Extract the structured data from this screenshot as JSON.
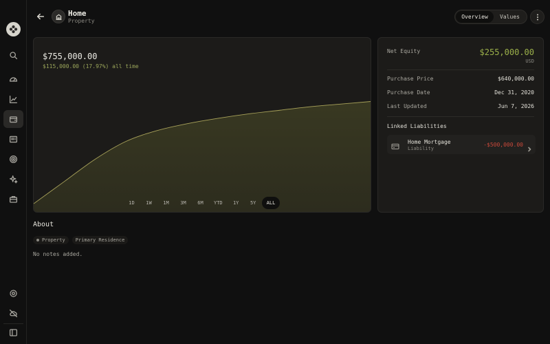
{
  "header": {
    "back_icon": "arrow-left-icon",
    "asset_icon": "building-icon",
    "title": "Home",
    "subtitle": "Property",
    "tabs": [
      {
        "label": "Overview",
        "active": true
      },
      {
        "label": "Values",
        "active": false
      }
    ],
    "more_icon": "more-vertical-icon"
  },
  "sidebar": {
    "logo_icon": "app-logo-icon",
    "items": [
      {
        "icon": "search-icon",
        "active": false
      },
      {
        "icon": "dashboard-gauge-icon",
        "active": false
      },
      {
        "icon": "chart-icon",
        "active": false
      },
      {
        "icon": "wallet-icon",
        "active": true
      },
      {
        "icon": "receipt-icon",
        "active": false
      },
      {
        "icon": "target-icon",
        "active": false
      },
      {
        "icon": "sparkles-icon",
        "active": false
      },
      {
        "icon": "briefcase-icon",
        "active": false
      }
    ],
    "bottom_items": [
      {
        "icon": "settings-icon"
      },
      {
        "icon": "cloud-off-icon"
      },
      {
        "icon": "sidebar-toggle-icon"
      }
    ]
  },
  "summary": {
    "value": "$755,000.00",
    "change": "$115,000.00 (17.97%) all time",
    "change_color": "#9aa55a"
  },
  "ranges": [
    {
      "label": "1D",
      "active": false
    },
    {
      "label": "1W",
      "active": false
    },
    {
      "label": "1M",
      "active": false
    },
    {
      "label": "3M",
      "active": false
    },
    {
      "label": "6M",
      "active": false
    },
    {
      "label": "YTD",
      "active": false
    },
    {
      "label": "1Y",
      "active": false
    },
    {
      "label": "5Y",
      "active": false
    },
    {
      "label": "ALL",
      "active": true
    }
  ],
  "chart_data": {
    "type": "area",
    "series": [
      {
        "values": [
          640000,
          665000,
          690000,
          710000,
          722000,
          730000,
          736000,
          741000,
          745000,
          749000,
          752000,
          755000
        ]
      }
    ],
    "ylim": [
      640000,
      780000
    ],
    "line_color": "#a9a35a",
    "fill_color": "#3a3a22"
  },
  "details": {
    "net_equity_label": "Net Equity",
    "net_equity_value": "$255,000.00",
    "net_equity_currency": "USD",
    "net_equity_color": "#9bb04a",
    "rows": [
      {
        "label": "Purchase Price",
        "value": "$640,000.00"
      },
      {
        "label": "Purchase Date",
        "value": "Dec 31, 2020"
      },
      {
        "label": "Last Updated",
        "value": "Jun 7, 2026"
      }
    ],
    "linked_title": "Linked Liabilities",
    "liabilities": [
      {
        "icon": "credit-card-icon",
        "name": "Home Mortgage",
        "type": "Liability",
        "amount": "-$500,000.00",
        "amount_color": "#c8483a"
      }
    ]
  },
  "about": {
    "title": "About",
    "tags": [
      "Property",
      "Primary Residence"
    ],
    "notes": "No notes added."
  }
}
